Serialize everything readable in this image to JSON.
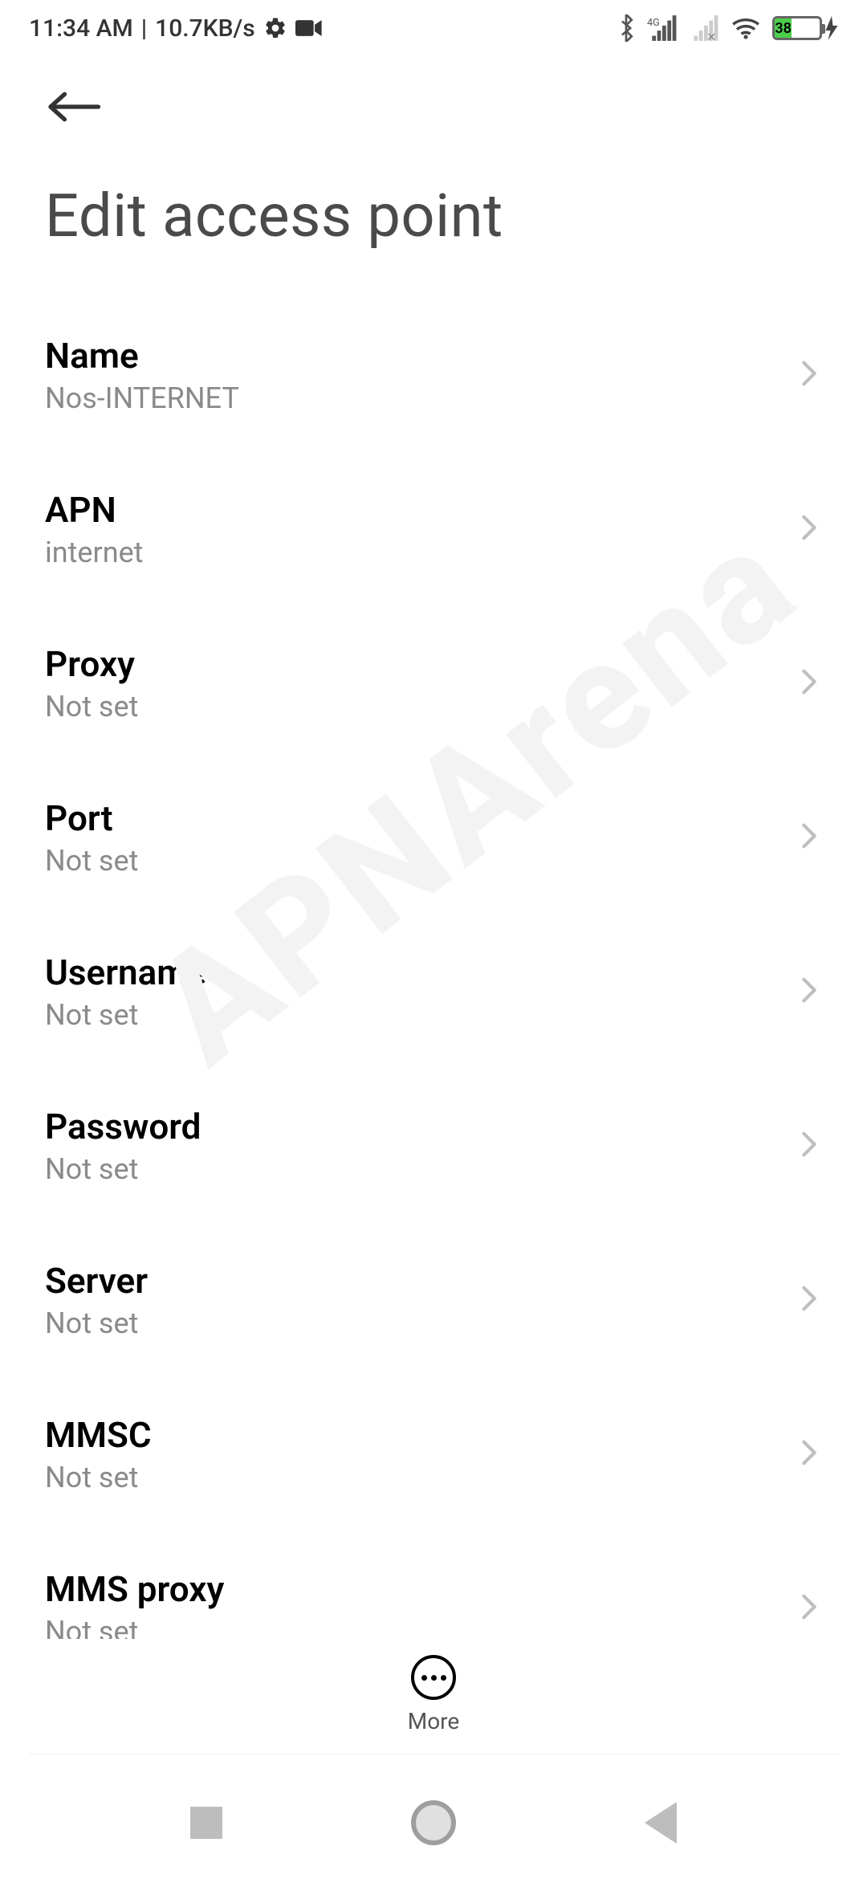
{
  "status": {
    "time": "11:34 AM",
    "net_speed": "10.7KB/s",
    "battery_pct": "38"
  },
  "page": {
    "title": "Edit access point"
  },
  "fields": {
    "name": {
      "label": "Name",
      "value": "Nos-INTERNET"
    },
    "apn": {
      "label": "APN",
      "value": "internet"
    },
    "proxy": {
      "label": "Proxy",
      "value": "Not set"
    },
    "port": {
      "label": "Port",
      "value": "Not set"
    },
    "username": {
      "label": "Username",
      "value": "Not set"
    },
    "password": {
      "label": "Password",
      "value": "Not set"
    },
    "server": {
      "label": "Server",
      "value": "Not set"
    },
    "mmsc": {
      "label": "MMSC",
      "value": "Not set"
    },
    "mmsproxy": {
      "label": "MMS proxy",
      "value": "Not set"
    }
  },
  "more_label": "More",
  "watermark": "APNArena"
}
